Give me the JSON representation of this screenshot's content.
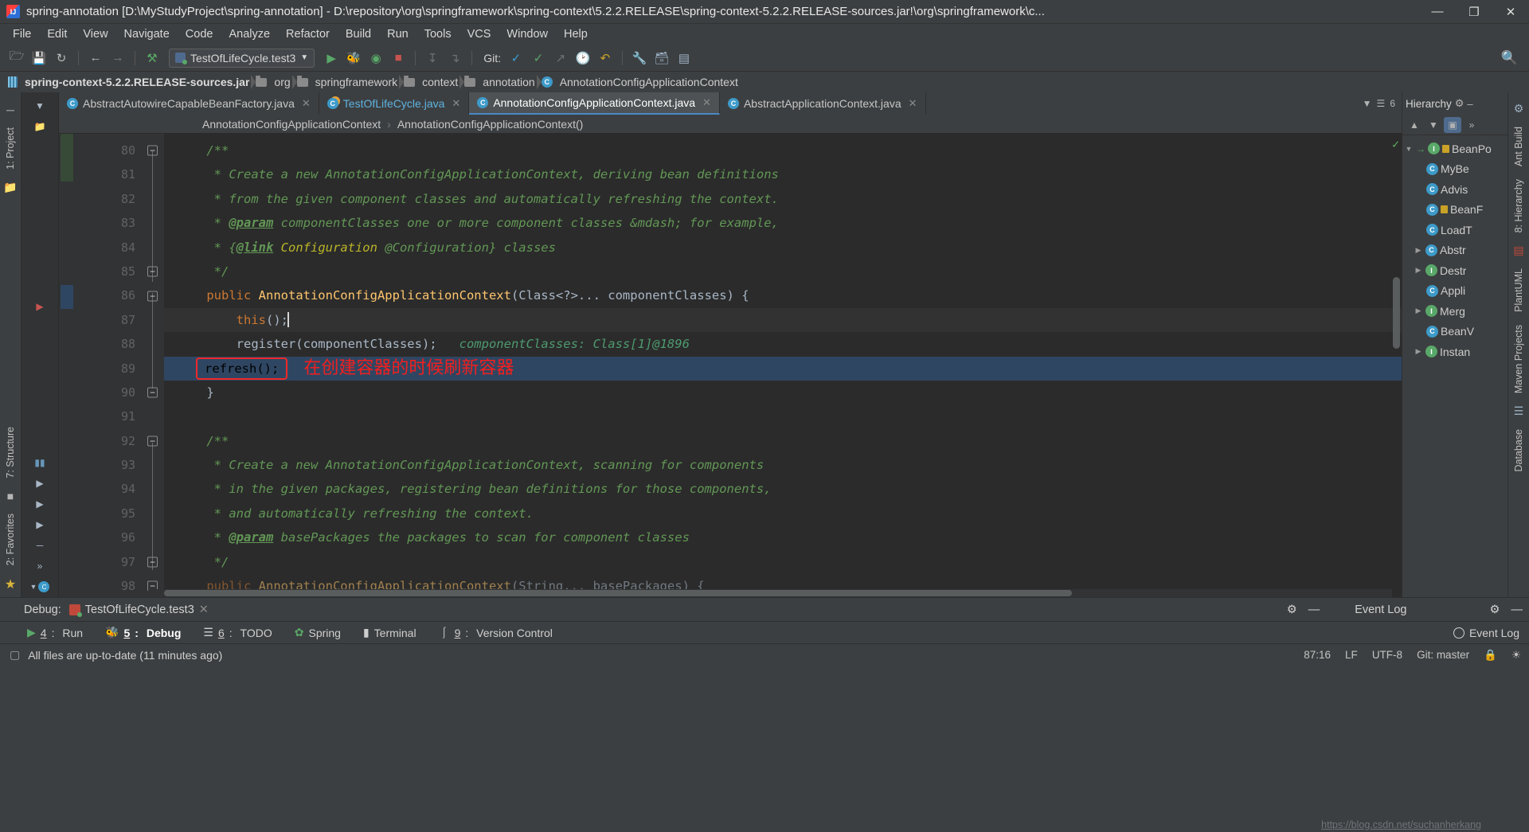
{
  "window": {
    "title": "spring-annotation [D:\\MyStudyProject\\spring-annotation] - D:\\repository\\org\\springframework\\spring-context\\5.2.2.RELEASE\\spring-context-5.2.2.RELEASE-sources.jar!\\org\\springframework\\c...",
    "minimize": "—",
    "maximize": "❐",
    "close": "✕"
  },
  "menu": [
    "File",
    "Edit",
    "View",
    "Navigate",
    "Code",
    "Analyze",
    "Refactor",
    "Build",
    "Run",
    "Tools",
    "VCS",
    "Window",
    "Help"
  ],
  "toolbar": {
    "open_label": "open-project",
    "save_label": "save-all",
    "sync_label": "sync",
    "back_label": "back",
    "forward_label": "forward",
    "build_label": "build",
    "run_config": "TestOfLifeCycle.test3",
    "run_label": "Run",
    "debug_label": "Debug",
    "run_coverage_label": "Run with Coverage",
    "stop_label": "Stop",
    "git_label": "Git:",
    "update_label": "Update Project",
    "commit_label": "Commit",
    "push_label": "Push",
    "history_label": "History",
    "revert_label": "Revert",
    "search_label": "Search Everywhere"
  },
  "navbar": [
    {
      "label": "spring-context-5.2.2.RELEASE-sources.jar",
      "icon": "jar-icon"
    },
    {
      "label": "org",
      "icon": "folder-icon"
    },
    {
      "label": "springframework",
      "icon": "folder-icon"
    },
    {
      "label": "context",
      "icon": "folder-icon"
    },
    {
      "label": "annotation",
      "icon": "folder-icon"
    },
    {
      "label": "AnnotationConfigApplicationContext",
      "icon": "class-icon"
    }
  ],
  "left_rail": [
    {
      "label": "1: Project",
      "name": "tool-window-project"
    },
    {
      "label": "2: Favorites",
      "name": "tool-window-favorites"
    },
    {
      "label": "7: Structure",
      "name": "tool-window-structure"
    }
  ],
  "right_rail": [
    {
      "label": "Ant Build",
      "name": "tool-window-ant-build"
    },
    {
      "label": "8: Hierarchy",
      "name": "tool-window-hierarchy"
    },
    {
      "label": "PlantUML",
      "name": "tool-window-plantuml"
    },
    {
      "label": "Maven Projects",
      "name": "tool-window-maven"
    },
    {
      "label": "Database",
      "name": "tool-window-database"
    }
  ],
  "tabs": [
    {
      "label": "AbstractAutowireCapableBeanFactory.java",
      "active": false,
      "kind": "class"
    },
    {
      "label": "TestOfLifeCycle.java",
      "active": false,
      "kind": "test"
    },
    {
      "label": "AnnotationConfigApplicationContext.java",
      "active": true,
      "kind": "class"
    },
    {
      "label": "AbstractApplicationContext.java",
      "active": false,
      "kind": "class"
    }
  ],
  "tabs_right": {
    "count": "6"
  },
  "breadcrumb": {
    "class": "AnnotationConfigApplicationContext",
    "separator": "›",
    "member": "AnnotationConfigApplicationContext()"
  },
  "code": {
    "first_line": 80,
    "lines": [
      {
        "n": 80,
        "segments": [
          {
            "t": "    ",
            "c": "pl"
          },
          {
            "t": "/**",
            "c": "cm"
          }
        ]
      },
      {
        "n": 81,
        "segments": [
          {
            "t": "     * Create a new AnnotationConfigApplicationContext, deriving bean definitions",
            "c": "cm"
          }
        ]
      },
      {
        "n": 82,
        "segments": [
          {
            "t": "     * from the given component classes and automatically refreshing the context.",
            "c": "cm"
          }
        ]
      },
      {
        "n": 83,
        "segments": [
          {
            "t": "     * ",
            "c": "cm"
          },
          {
            "t": "@param",
            "c": "cm-tag"
          },
          {
            "t": " componentClasses one or more component classes &mdash; for example,",
            "c": "cm"
          }
        ]
      },
      {
        "n": 84,
        "segments": [
          {
            "t": "     * {",
            "c": "cm"
          },
          {
            "t": "@link",
            "c": "cm-tag"
          },
          {
            "t": " Configuration ",
            "c": "cm-lnk"
          },
          {
            "t": "@Configuration} classes",
            "c": "cm"
          }
        ]
      },
      {
        "n": 85,
        "segments": [
          {
            "t": "     */",
            "c": "cm"
          }
        ]
      },
      {
        "n": 86,
        "segments": [
          {
            "t": "    ",
            "c": "pl"
          },
          {
            "t": "public ",
            "c": "kw"
          },
          {
            "t": "AnnotationConfigApplicationContext",
            "c": "id"
          },
          {
            "t": "(Class<?>... componentClasses) {",
            "c": "pl"
          }
        ]
      },
      {
        "n": 87,
        "segments": [
          {
            "t": "        ",
            "c": "pl"
          },
          {
            "t": "this",
            "c": "kw"
          },
          {
            "t": "();",
            "c": "pl"
          }
        ],
        "caret": true,
        "caret_line": true
      },
      {
        "n": 88,
        "segments": [
          {
            "t": "        register(componentClasses);",
            "c": "pl"
          },
          {
            "t": "   componentClasses: Class[1]@1896",
            "c": "hint"
          }
        ]
      },
      {
        "n": 89,
        "segments": [],
        "highlighted": true,
        "boxed_text": "refresh();",
        "note": "在创建容器的时候刷新容器"
      },
      {
        "n": 90,
        "segments": [
          {
            "t": "    }",
            "c": "pl"
          }
        ]
      },
      {
        "n": 91,
        "segments": []
      },
      {
        "n": 92,
        "segments": [
          {
            "t": "    ",
            "c": "pl"
          },
          {
            "t": "/**",
            "c": "cm"
          }
        ]
      },
      {
        "n": 93,
        "segments": [
          {
            "t": "     * Create a new AnnotationConfigApplicationContext, scanning for components",
            "c": "cm"
          }
        ]
      },
      {
        "n": 94,
        "segments": [
          {
            "t": "     * in the given packages, registering bean definitions for those components,",
            "c": "cm"
          }
        ]
      },
      {
        "n": 95,
        "segments": [
          {
            "t": "     * and automatically refreshing the context.",
            "c": "cm"
          }
        ]
      },
      {
        "n": 96,
        "segments": [
          {
            "t": "     * ",
            "c": "cm"
          },
          {
            "t": "@param",
            "c": "cm-tag"
          },
          {
            "t": " basePackages the packages to scan for component classes",
            "c": "cm"
          }
        ]
      },
      {
        "n": 97,
        "segments": [
          {
            "t": "     */",
            "c": "cm"
          }
        ]
      },
      {
        "n": 98,
        "segments": [
          {
            "t": "    ",
            "c": "pl"
          },
          {
            "t": "public ",
            "c": "kw"
          },
          {
            "t": "AnnotationConfigApplicationContext",
            "c": "id"
          },
          {
            "t": "(String... basePackages) {",
            "c": "pl"
          }
        ]
      }
    ]
  },
  "hierarchy": {
    "title": "Hierarchy",
    "settings_icon": "gear-icon",
    "minimize_icon": "minimize-icon",
    "tools": [
      "subtypes-hierarchy-icon",
      "supertypes-hierarchy-icon",
      "class-hierarchy-icon",
      "more-icon"
    ],
    "tree": [
      {
        "label": "BeanPo",
        "depth": 0,
        "expanded": true,
        "kind": "interface",
        "arrow": true
      },
      {
        "label": "MyBe",
        "depth": 1,
        "expanded": null,
        "kind": "class"
      },
      {
        "label": "Advis",
        "depth": 1,
        "expanded": null,
        "kind": "class"
      },
      {
        "label": "BeanF",
        "depth": 1,
        "expanded": null,
        "kind": "class",
        "lock": true
      },
      {
        "label": "LoadT",
        "depth": 1,
        "expanded": null,
        "kind": "class"
      },
      {
        "label": "Abstr",
        "depth": 1,
        "expanded": false,
        "kind": "class"
      },
      {
        "label": "Destr",
        "depth": 1,
        "expanded": false,
        "kind": "interface"
      },
      {
        "label": "Appli",
        "depth": 1,
        "expanded": null,
        "kind": "class"
      },
      {
        "label": "Merg",
        "depth": 1,
        "expanded": false,
        "kind": "interface"
      },
      {
        "label": "BeanV",
        "depth": 1,
        "expanded": null,
        "kind": "class"
      },
      {
        "label": "Instan",
        "depth": 1,
        "expanded": false,
        "kind": "interface"
      }
    ]
  },
  "debug_bar": {
    "label": "Debug:",
    "session": "TestOfLifeCycle.test3",
    "close": "✕",
    "settings_icon": "gear-icon",
    "hide_icon": "—",
    "event_log_label": "Event Log",
    "event_settings_icon": "gear-icon",
    "event_hide_icon": "—"
  },
  "bottom_tabs": [
    {
      "num": "4",
      "label": "Run",
      "icon": "run-icon",
      "active": false
    },
    {
      "num": "5",
      "label": "Debug",
      "icon": "debug-icon",
      "active": true
    },
    {
      "num": "6",
      "label": "TODO",
      "icon": "todo-icon",
      "active": false
    },
    {
      "num": "",
      "label": "Spring",
      "icon": "spring-icon",
      "active": false
    },
    {
      "num": "",
      "label": "Terminal",
      "icon": "terminal-icon",
      "active": false
    },
    {
      "num": "9",
      "label": "Version Control",
      "icon": "vcs-icon",
      "active": false
    }
  ],
  "bottom_right": {
    "event_log": "Event Log"
  },
  "status": {
    "message": "All files are up-to-date (11 minutes ago)",
    "caret": "87:16",
    "line_sep": "LF",
    "encoding": "UTF-8",
    "branch": "Git: master",
    "lock_icon": "lock-icon",
    "watermark": "https://blog.csdn.net/suchanherkang"
  },
  "colors": {
    "accent": "#4a88c7",
    "selection": "#2f4662",
    "annotation_red": "#ef2020",
    "comment_green": "#629755",
    "keyword_orange": "#cc7832",
    "method_yellow": "#ffc66d",
    "editor_bg": "#2b2b2b",
    "chrome_bg": "#3c3f41"
  }
}
